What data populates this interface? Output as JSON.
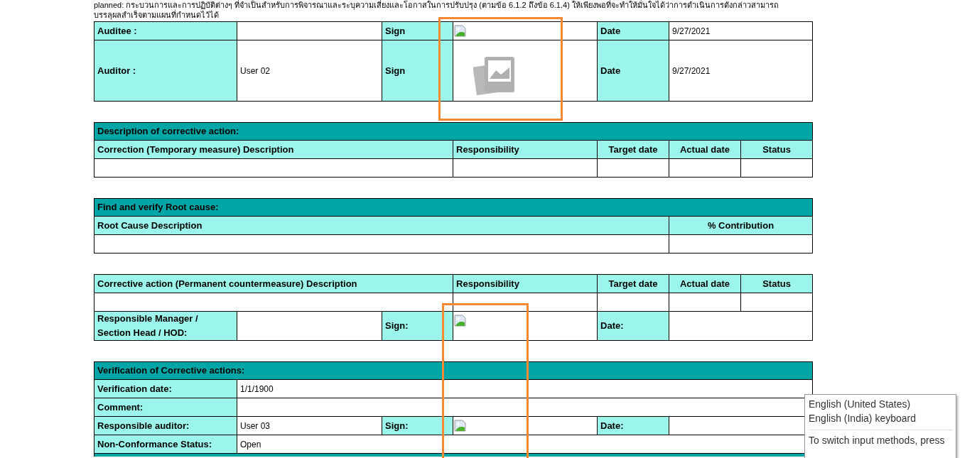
{
  "intro_text": [
    "planned: กระบวนการและการปฏิบัติต่างๆ ที่จำเป็นสำหรับการพิจารณาและระบุความเสี่ยงและโอกาสในการปรับปรุง (ตามข้อ 6.1.2 ถึงข้อ 6.1.4) ให้เพียงพอที่จะทำให้มั่นใจได้ว่าการดำเนินการดังกล่าวสามารถ",
    "บรรลุผลสำเร็จตามแผนที่กำหนดไว้ได้"
  ],
  "sections": [
    {
      "kind": "signoff",
      "fields": [
        {
          "kind": "broken_image",
          "label": "Auditee :",
          "sign_label": "Sign",
          "date_label": "Date",
          "date": "9/27/2021"
        },
        {
          "kind": "no_image",
          "label": "Auditor :",
          "value": "User 02",
          "sign_label": "Sign",
          "date_label": "Date",
          "date": "9/27/2021"
        }
      ]
    },
    {
      "kind": "grid",
      "title": "Description of corrective action:",
      "columns": [
        "Correction (Temporary measure) Description",
        "Responsibility",
        "Target date",
        "Actual date",
        "Status"
      ]
    },
    {
      "kind": "grid",
      "title": "Find and verify Root cause:",
      "columns": [
        "Root Cause Description",
        "% Contribution"
      ]
    },
    {
      "kind": "grid",
      "columns": [
        "Corrective action (Permanent countermeasure) Description",
        "Responsibility",
        "Target date",
        "Actual date",
        "Status"
      ],
      "fields": [
        {
          "kind": "broken_image",
          "label": "Responsible Manager / Section Head / HOD:",
          "sign_label": "Sign:",
          "date_label": "Date:"
        }
      ]
    },
    {
      "kind": "form",
      "title": "Verification of Corrective actions:",
      "continues": true,
      "fields": [
        {
          "kind": "line",
          "label": "Verification date:",
          "value": "1/1/1900"
        },
        {
          "kind": "line",
          "label": "Comment:"
        },
        {
          "kind": "broken_image",
          "label": "Responsible auditor:",
          "value": "User 03",
          "sign_label": "Sign:",
          "date_label": "Date:"
        },
        {
          "kind": "line",
          "label": "Non-Conformance Status:",
          "value": "Open"
        }
      ]
    }
  ],
  "input_popup": {
    "items": [
      "English (United States)",
      "English (India) keyboard"
    ],
    "hint": "To switch input methods, press"
  }
}
